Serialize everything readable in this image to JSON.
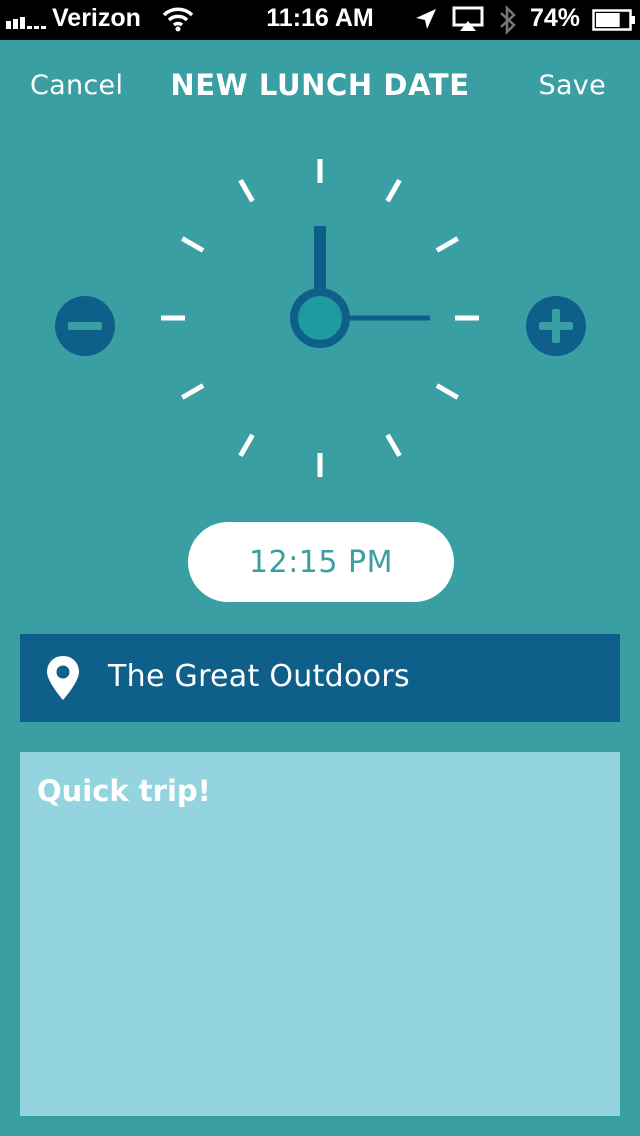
{
  "status_bar": {
    "carrier": "Verizon",
    "time": "11:16 AM",
    "battery": "74%",
    "battery_level": 0.74,
    "icons": [
      "signal-icon",
      "wifi-icon",
      "location-arrow-icon",
      "airplay-icon",
      "bluetooth-icon",
      "battery-icon"
    ]
  },
  "nav": {
    "cancel_label": "Cancel",
    "title": "NEW LUNCH DATE",
    "save_label": "Save"
  },
  "clock": {
    "hour": 12,
    "minute": 15,
    "controls": [
      "minus-icon",
      "plus-icon"
    ]
  },
  "time_display": "12:15 PM",
  "location": {
    "icon": "map-pin-icon",
    "text": "The Great Outdoors"
  },
  "notes": {
    "text": "Quick trip!"
  },
  "colors": {
    "background": "#3a9fa3",
    "accent_dark": "#0e5f8a",
    "notes_bg": "#93d4de",
    "white": "#ffffff"
  }
}
